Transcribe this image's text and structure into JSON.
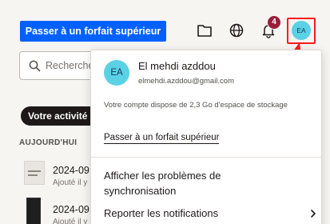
{
  "header": {
    "upgrade_button": "Passer à un forfait supérieur",
    "notification_count": "4",
    "avatar_initials": "EA",
    "icons": [
      "folder-icon",
      "globe-icon",
      "bell-icon"
    ]
  },
  "search": {
    "placeholder": "Rechercher"
  },
  "activity": {
    "filter_label": "Votre activité",
    "section_label": "AUJOURD'HUI",
    "files": [
      {
        "name": "2024-09",
        "sub": "Ajouté il y"
      },
      {
        "name": "2024-09",
        "sub": "Ajouté il y"
      }
    ]
  },
  "account_menu": {
    "avatar_initials": "EA",
    "name": "El mehdi azddou",
    "email": "elmehdi.azddou@gmail.com",
    "storage_text": "Votre compte dispose de 2,3 Go d'espace de stockage",
    "upgrade_link": "Passer à un forfait supérieur",
    "items": [
      {
        "label": "Afficher les problèmes de synchronisation"
      },
      {
        "label": "Reporter les notifications"
      }
    ]
  },
  "colors": {
    "brand_blue": "#0061fe",
    "avatar_bg": "#5bd1e6",
    "badge_bg": "#9b1d3a",
    "annotation_red": "#ff1a1a"
  }
}
